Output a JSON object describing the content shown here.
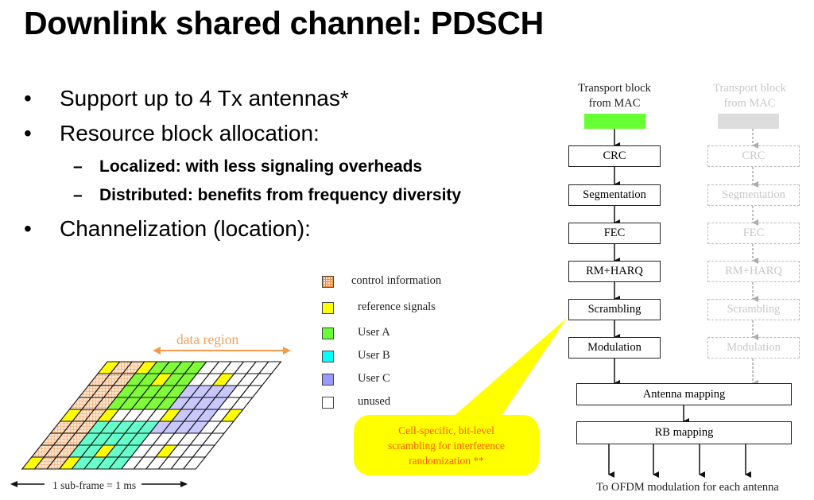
{
  "title": "Downlink shared channel: PDSCH",
  "bullets": [
    {
      "marker": "•",
      "text": "Support up to 4 Tx antennas*"
    },
    {
      "marker": "•",
      "text": "Resource block allocation:"
    },
    {
      "marker": "•",
      "text": "Channelization (location):"
    }
  ],
  "sub_bullets": [
    {
      "marker": "–",
      "text": "Localized: with less signaling overheads"
    },
    {
      "marker": "–",
      "text": "Distributed: benefits from frequency diversity"
    }
  ],
  "resource_grid": {
    "data_region_label": "data region",
    "subframe_label": "1 sub-frame = 1 ms",
    "rows": [
      "YHHYGGGGWWWWWW",
      "HHHGGYGGWWYWWW",
      "HHHGGGGGPPPPWW",
      "HHHGGGGGPPPPWW",
      "YHHYWWWWYPPPWY",
      "HHHCCCCCPPPPWW",
      "HHHCCCCCWWWWWW",
      "HHHCCYCCWWYWWW",
      "YHHYCCCCWWWWWW"
    ],
    "colors": {
      "H": "#fbd2ad",
      "Y": "#ffff00",
      "G": "#80fb3a",
      "C": "#66ffcc",
      "P": "#c8c8ff",
      "W": "#ffffff",
      "hatch_line": "#f08a3c"
    }
  },
  "legend": [
    {
      "label": "control information",
      "color": "#fbd2ad",
      "hatched": true
    },
    {
      "label": "reference signals",
      "color": "#ffff00"
    },
    {
      "label": "User A",
      "color": "#66ff33"
    },
    {
      "label": "User B",
      "color": "#00ffff"
    },
    {
      "label": "User C",
      "color": "#9999ff"
    },
    {
      "label": "unused",
      "color": "#ffffff"
    }
  ],
  "callout": {
    "lines": [
      "Cell-specific, bit-level",
      "scrambling for interference",
      "randomization **"
    ],
    "color": "#ffff00",
    "text_color": "#ff5a00"
  },
  "flow": {
    "source_title": [
      "Transport block",
      "from MAC"
    ],
    "source_color": "#66ff33",
    "ghost_color": "#dddddd",
    "steps": [
      "CRC",
      "Segmentation",
      "FEC",
      "RM+HARQ",
      "Scrambling",
      "Modulation"
    ],
    "antenna_mapping": "Antenna mapping",
    "rb_mapping": "RB  mapping",
    "output": "To OFDM modulation for each antenna"
  }
}
